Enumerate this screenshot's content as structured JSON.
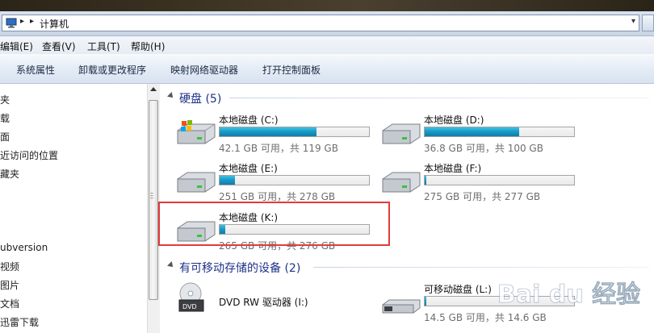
{
  "address": {
    "path": "计算机"
  },
  "menu": {
    "items": [
      "编辑(E)",
      "查看(V)",
      "工具(T)",
      "帮助(H)"
    ]
  },
  "toolbar": {
    "buttons": [
      "系统属性",
      "卸载或更改程序",
      "映射网络驱动器",
      "打开控制面板"
    ]
  },
  "nav": {
    "items": [
      "夹",
      "载",
      "面",
      "近访问的位置",
      "藏夹",
      "ubversion",
      "视频",
      "图片",
      "文档",
      "迅雷下载"
    ]
  },
  "groups": {
    "hard_disks": "硬盘 (5)",
    "removable": "有可移动存储的设备 (2)"
  },
  "drives": [
    {
      "name": "本地磁盘 (C:)",
      "free": "42.1 GB 可用，共 119 GB",
      "used_fraction": 0.65
    },
    {
      "name": "本地磁盘 (D:)",
      "free": "36.8 GB 可用，共 100 GB",
      "used_fraction": 0.63
    },
    {
      "name": "本地磁盘 (E:)",
      "free": "251 GB 可用，共 278 GB",
      "used_fraction": 0.1
    },
    {
      "name": "本地磁盘 (F:)",
      "free": "275 GB 可用，共 277 GB",
      "used_fraction": 0.01
    },
    {
      "name": "本地磁盘 (K:)",
      "free": "265 GB 可用，共 276 GB",
      "used_fraction": 0.04
    }
  ],
  "removable": [
    {
      "name": "DVD RW 驱动器 (I:)",
      "label": "DVD"
    },
    {
      "name": "可移动磁盘 (L:)",
      "free": "14.5 GB 可用，共 14.6 GB",
      "used_fraction": 0.01
    }
  ],
  "watermark": "Bai du 经验"
}
